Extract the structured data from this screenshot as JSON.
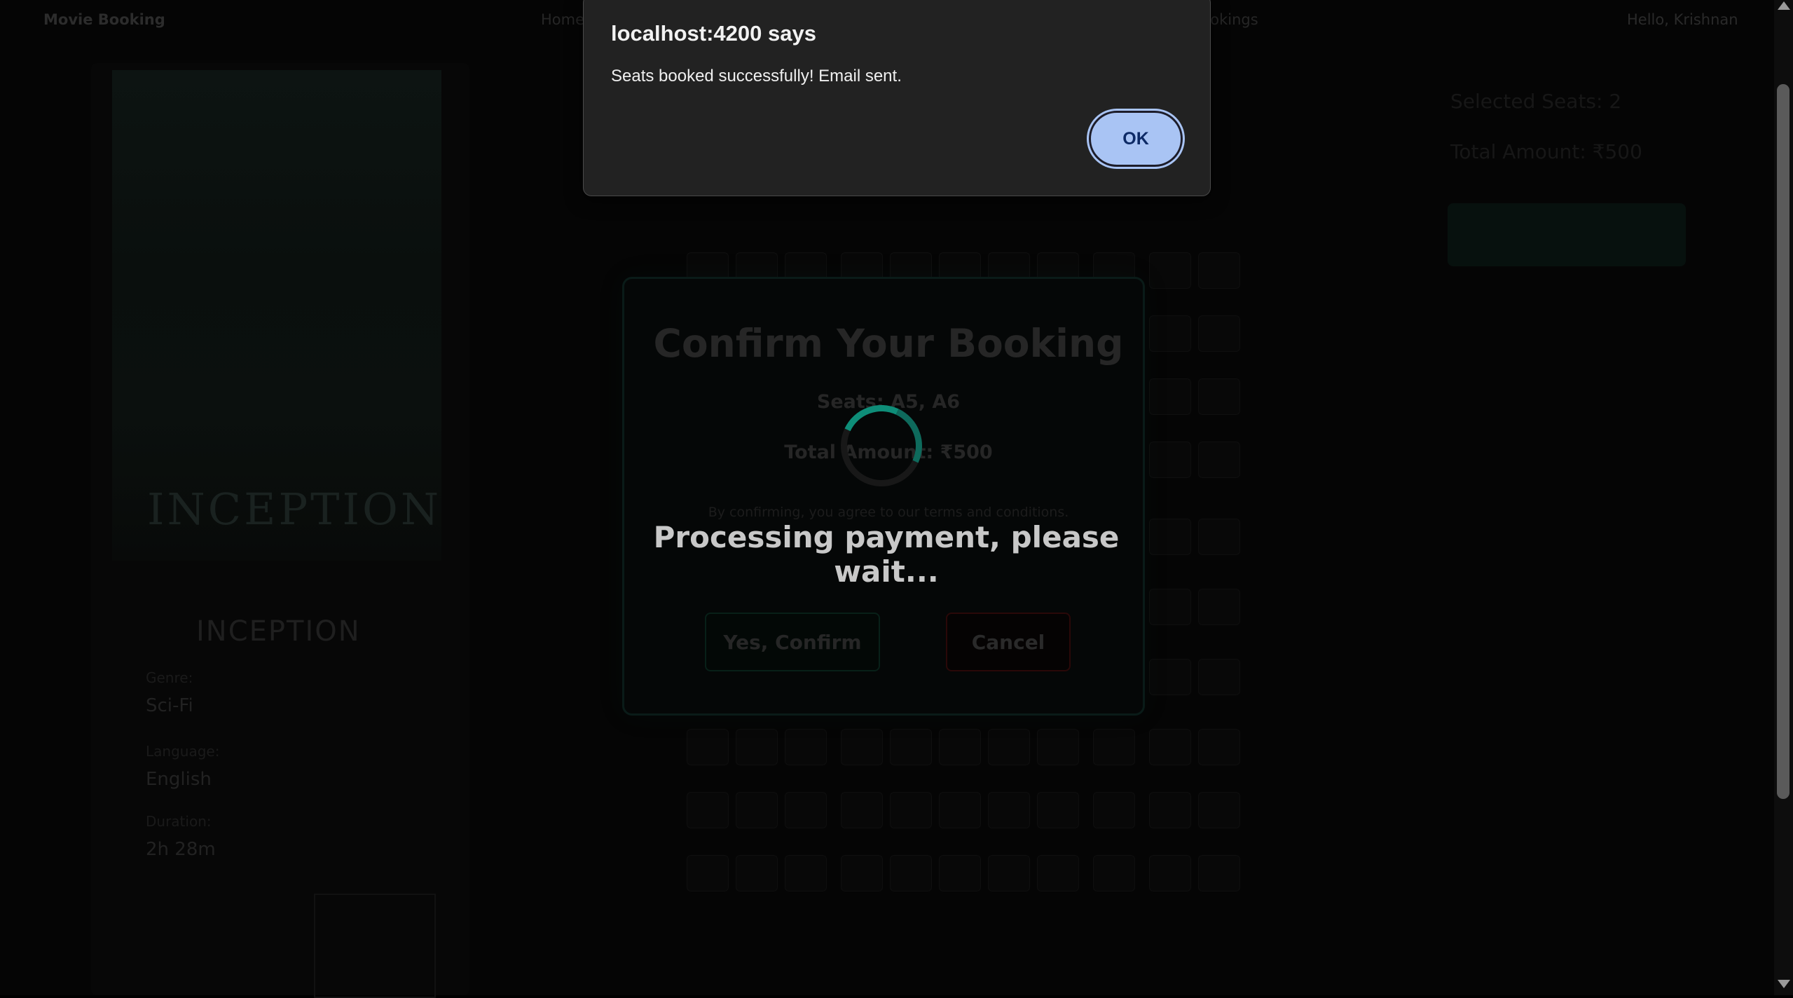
{
  "app": {
    "brand": "Movie Booking",
    "home_link": "Home",
    "nav_right": "Bookings",
    "user": "Hello, Krishnan"
  },
  "movie": {
    "poster_text": "INCEPTION",
    "title": "INCEPTION",
    "genre_label": "Genre:",
    "genre": "Sci-Fi",
    "language_label": "Language:",
    "language": "English",
    "duration_label": "Duration:",
    "duration": "2h 28m"
  },
  "summary": {
    "selected": "Selected Seats: 2",
    "total": "Total Amount: ₹500"
  },
  "confirm_modal": {
    "title": "Confirm Your Booking",
    "seats": "Seats: A5, A6",
    "amount": "Total Amount: ₹500",
    "terms": "By confirming, you agree to our terms and conditions.",
    "yes_label": "Yes, Confirm",
    "cancel_label": "Cancel"
  },
  "processing": {
    "message": "Processing payment, please wait..."
  },
  "alert": {
    "title": "localhost:4200 says",
    "message": "Seats booked successfully! Email sent.",
    "ok_label": "OK"
  },
  "colors": {
    "spinner_accent": "#0e8d78",
    "ok_button": "#a9c4f4",
    "alert_bg": "#222222"
  }
}
